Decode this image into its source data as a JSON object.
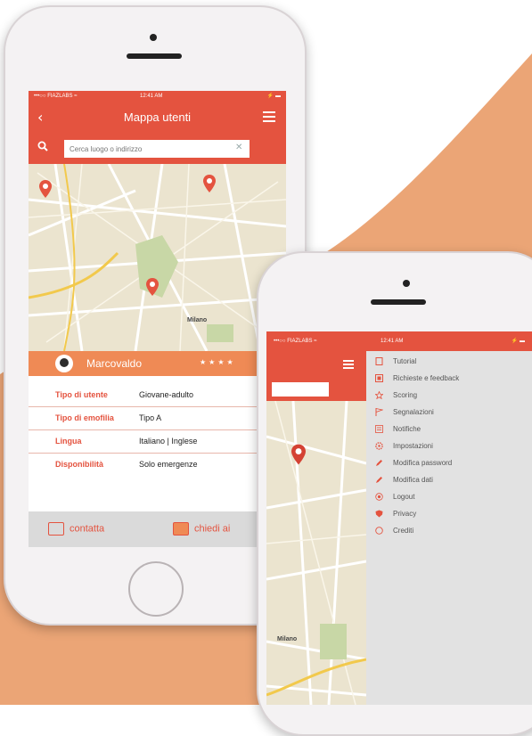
{
  "colors": {
    "accent": "#e4533f",
    "panel": "#ef8a55",
    "background_blob": "#eba576",
    "drawer": "#e2e2e2"
  },
  "phone1": {
    "status": {
      "carrier": "•••○○ FIAZLABS ≈",
      "time": "12:41 AM",
      "battery": "⚡ ▬"
    },
    "header": {
      "title": "Mappa utenti",
      "back_icon": "chevron-left-icon",
      "menu_icon": "hamburger-icon"
    },
    "search": {
      "placeholder": "Cerca luogo o indirizzo",
      "clear": "✕"
    },
    "map": {
      "city_label": "Milano"
    },
    "user": {
      "name": "Marcovaldo",
      "stars": "★★★★"
    },
    "info": [
      {
        "key": "Tipo di utente",
        "value": "Giovane-adulto"
      },
      {
        "key": "Tipo di emofilia",
        "value": "Tipo A"
      },
      {
        "key": "Lingua",
        "value": "Italiano | Inglese"
      },
      {
        "key": "Disponibilità",
        "value": "Solo emergenze"
      }
    ],
    "actions": {
      "contact": "contatta",
      "ask": "chiedi ai"
    }
  },
  "phone2": {
    "status": {
      "carrier": "•••○○ FIAZLABS ≈",
      "time": "12:41 AM",
      "battery": "⚡ ▬"
    },
    "map": {
      "city_label": "Milano"
    },
    "menu": [
      {
        "label": "Tutorial",
        "icon": "document-icon"
      },
      {
        "label": "Richieste e feedback",
        "icon": "feedback-icon"
      },
      {
        "label": "Scoring",
        "icon": "star-icon"
      },
      {
        "label": "Segnalazioni",
        "icon": "flag-icon"
      },
      {
        "label": "Notifiche",
        "icon": "bell-icon"
      },
      {
        "label": "Impostazioni",
        "icon": "gear-icon"
      },
      {
        "label": "Modifica password",
        "icon": "pencil-icon"
      },
      {
        "label": "Modifica dati",
        "icon": "pencil-icon"
      },
      {
        "label": "Logout",
        "icon": "logout-icon"
      },
      {
        "label": "Privacy",
        "icon": "shield-icon"
      },
      {
        "label": "Crediti",
        "icon": "info-icon"
      }
    ]
  }
}
